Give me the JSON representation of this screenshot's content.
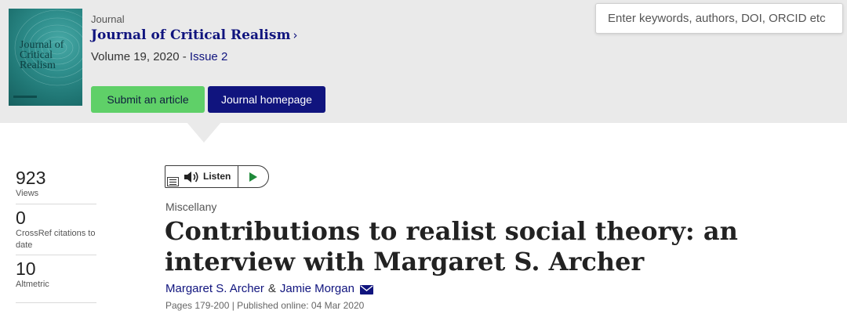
{
  "journal": {
    "label": "Journal",
    "title": "Journal of Critical Realism",
    "chevron": "›",
    "volume_text": "Volume 19, 2020 - ",
    "issue_link": "Issue 2",
    "cover_title": "Journal of Critical Realism"
  },
  "buttons": {
    "submit_label": "Submit an article",
    "homepage_label": "Journal homepage"
  },
  "search": {
    "placeholder": "Enter keywords, authors, DOI, ORCID etc"
  },
  "metrics": [
    {
      "value": "923",
      "label": "Views"
    },
    {
      "value": "0",
      "label": "CrossRef citations to date"
    },
    {
      "value": "10",
      "label": "Altmetric"
    }
  ],
  "listen": {
    "label": "Listen"
  },
  "article": {
    "category": "Miscellany",
    "title": "Contributions to realist social theory: an interview with Margaret S. Archer",
    "author1": "Margaret S. Archer",
    "amp": "&",
    "author2": "Jamie Morgan",
    "pages_line": "Pages 179-200 | Published online: 04 Mar 2020"
  },
  "colors": {
    "brand_navy": "#10147e",
    "submit_green": "#5fd068",
    "header_bg": "#eaeaea",
    "play_green": "#1f8a3a"
  },
  "icons": [
    "listen-menu-icon",
    "speaker-icon",
    "play-icon",
    "mail-icon",
    "chevron-right-icon"
  ]
}
